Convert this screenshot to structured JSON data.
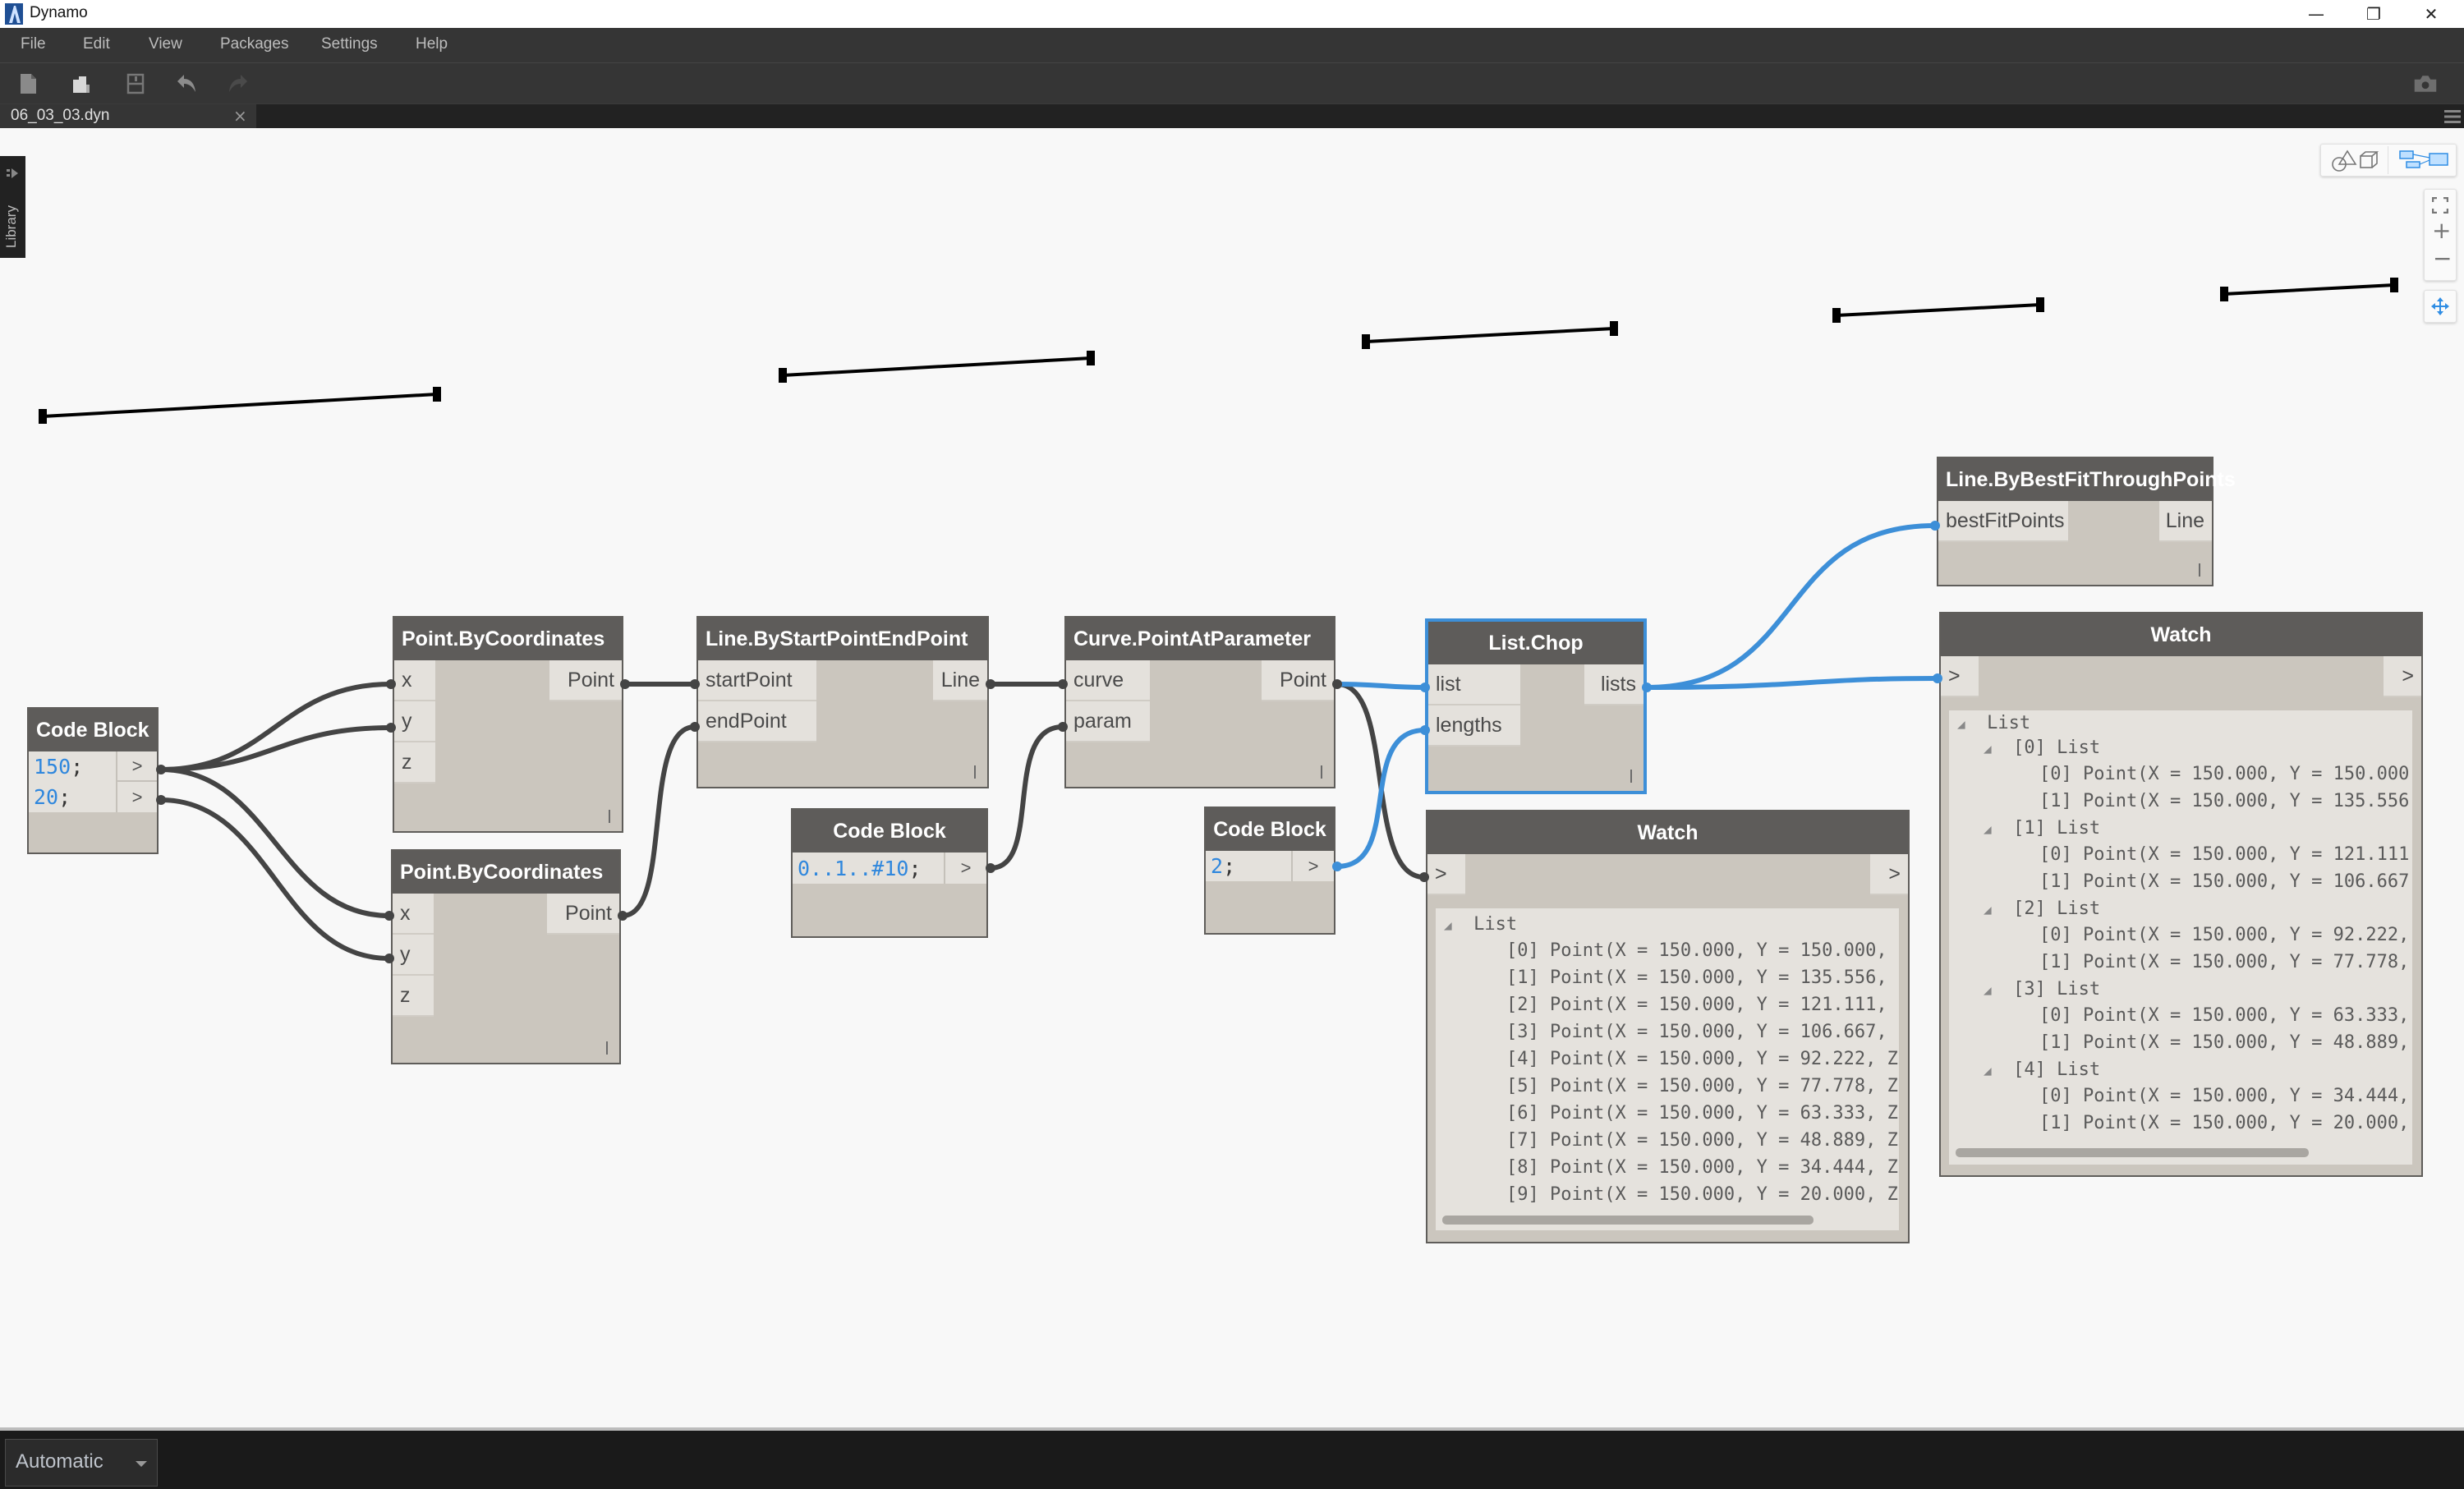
{
  "window": {
    "title": "Dynamo",
    "controls": {
      "minimize": "—",
      "restore": "❐",
      "close": "✕"
    }
  },
  "menu": [
    "File",
    "Edit",
    "View",
    "Packages",
    "Settings",
    "Help"
  ],
  "toolbar": {
    "icons": [
      "new-file-icon",
      "open-file-icon",
      "save-icon",
      "undo-icon",
      "redo-icon",
      "screenshot-camera-icon"
    ]
  },
  "tabs": [
    {
      "label": "06_03_03.dyn",
      "close": "×",
      "active": true
    }
  ],
  "library": {
    "label": "Library"
  },
  "view_controls": {
    "geometry_view": "geometry-view-icon",
    "graph_view": "graph-view-icon",
    "zoom_fit": "zoom-to-fit-icon",
    "zoom_in": "+",
    "zoom_out": "−",
    "pan": "pan-icon"
  },
  "colors": {
    "wire_default": "#444444",
    "wire_selected": "#3d8fd8",
    "node_header": "#5e5c5a",
    "node_body": "#cbc6be",
    "code_number": "#2f87dd"
  },
  "nodes": {
    "code_block_1": {
      "title": "Code Block",
      "lines": [
        {
          "value": "150",
          "semi": ";"
        },
        {
          "value": "20",
          "semi": ";"
        }
      ],
      "output": ">"
    },
    "point_by_coords_1": {
      "title": "Point.ByCoordinates",
      "inputs": [
        "x",
        "y",
        "z"
      ],
      "output": "Point"
    },
    "point_by_coords_2": {
      "title": "Point.ByCoordinates",
      "inputs": [
        "x",
        "y",
        "z"
      ],
      "output": "Point"
    },
    "line_by_start_end": {
      "title": "Line.ByStartPointEndPoint",
      "inputs": [
        "startPoint",
        "endPoint"
      ],
      "output": "Line"
    },
    "code_block_2": {
      "title": "Code Block",
      "lines": [
        {
          "value": "0..1..#10",
          "semi": ";"
        }
      ],
      "output": ">"
    },
    "curve_point_at_param": {
      "title": "Curve.PointAtParameter",
      "inputs": [
        "curve",
        "param"
      ],
      "output": "Point"
    },
    "code_block_3": {
      "title": "Code Block",
      "lines": [
        {
          "value": "2",
          "semi": ";"
        }
      ],
      "output": ">"
    },
    "list_chop": {
      "title": "List.Chop",
      "inputs": [
        "list",
        "lengths"
      ],
      "output": "lists",
      "selected": true
    },
    "line_best_fit": {
      "title": "Line.ByBestFitThroughPoints",
      "inputs": [
        "bestFitPoints"
      ],
      "output": "Line"
    },
    "watch_1": {
      "title": "Watch",
      "input": ">",
      "output": ">",
      "root": "List",
      "items": [
        "[0] Point(X = 150.000, Y = 150.000,",
        "[1] Point(X = 150.000, Y = 135.556,",
        "[2] Point(X = 150.000, Y = 121.111,",
        "[3] Point(X = 150.000, Y = 106.667,",
        "[4] Point(X = 150.000, Y = 92.222, Z",
        "[5] Point(X = 150.000, Y = 77.778, Z",
        "[6] Point(X = 150.000, Y = 63.333, Z",
        "[7] Point(X = 150.000, Y = 48.889, Z",
        "[8] Point(X = 150.000, Y = 34.444, Z",
        "[9] Point(X = 150.000, Y = 20.000, Z"
      ]
    },
    "watch_2": {
      "title": "Watch",
      "input": ">",
      "output": ">",
      "root": "List",
      "groups": [
        {
          "label": "[0] List",
          "items": [
            "[0] Point(X = 150.000, Y = 150.000",
            "[1] Point(X = 150.000, Y = 135.556"
          ]
        },
        {
          "label": "[1] List",
          "items": [
            "[0] Point(X = 150.000, Y = 121.111",
            "[1] Point(X = 150.000, Y = 106.667"
          ]
        },
        {
          "label": "[2] List",
          "items": [
            "[0] Point(X = 150.000, Y = 92.222,",
            "[1] Point(X = 150.000, Y = 77.778,"
          ]
        },
        {
          "label": "[3] List",
          "items": [
            "[0] Point(X = 150.000, Y = 63.333,",
            "[1] Point(X = 150.000, Y = 48.889,"
          ]
        },
        {
          "label": "[4] List",
          "items": [
            "[0] Point(X = 150.000, Y = 34.444,",
            "[1] Point(X = 150.000, Y = 20.000,"
          ]
        }
      ]
    }
  },
  "preview_geometry": {
    "type": "lines",
    "count": 5
  },
  "run_mode": {
    "selected": "Automatic"
  }
}
